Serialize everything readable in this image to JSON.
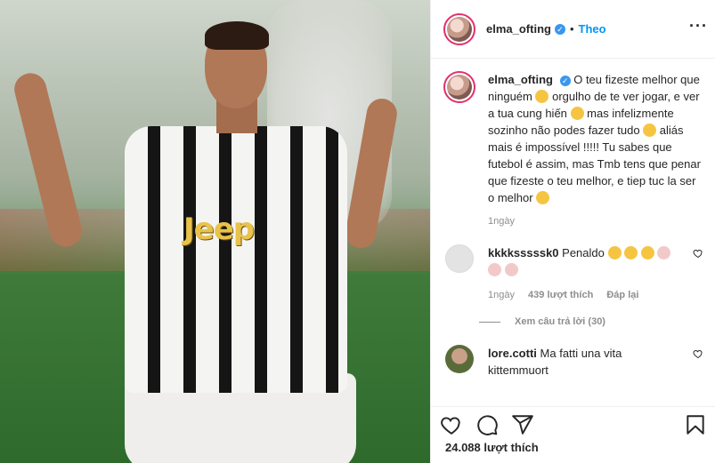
{
  "post": {
    "author": "elma_ofting",
    "follow_label": "Theo",
    "separator": "•",
    "caption": {
      "part1": "O teu fizeste melhor que ninguém ",
      "part2": " orgulho de te ver jogar, e ver a tua cung hiến ",
      "part3": " mas infelizmente sozinho não podes fazer tudo ",
      "part4": " aliás mais é impossível !!!!! Tu sabes que futebol é assim, mas Tmb tens que penar que fizeste o teu melhor, e tiep tuc la ser o melhor ",
      "time": "1ngày"
    },
    "photo": {
      "sponsor_text": "Jeep"
    },
    "likes": "24.088 lượt thích"
  },
  "comments": [
    {
      "user": "kkkksssssk0",
      "text": "Penaldo",
      "time": "1ngày",
      "likes": "439 lượt thích",
      "reply": "Đáp lại",
      "view_replies": "Xem câu trả lời (30)"
    },
    {
      "user": "lore.cotti",
      "text": "Ma fatti una vita kittemmuort"
    }
  ],
  "icons": [
    "more-icon",
    "verified-icon",
    "heart-icon",
    "comment-icon",
    "share-icon",
    "bookmark-icon"
  ],
  "colors": {
    "accent": "#0095f6",
    "verified": "#3897f0",
    "muted": "#8e8e8e"
  }
}
